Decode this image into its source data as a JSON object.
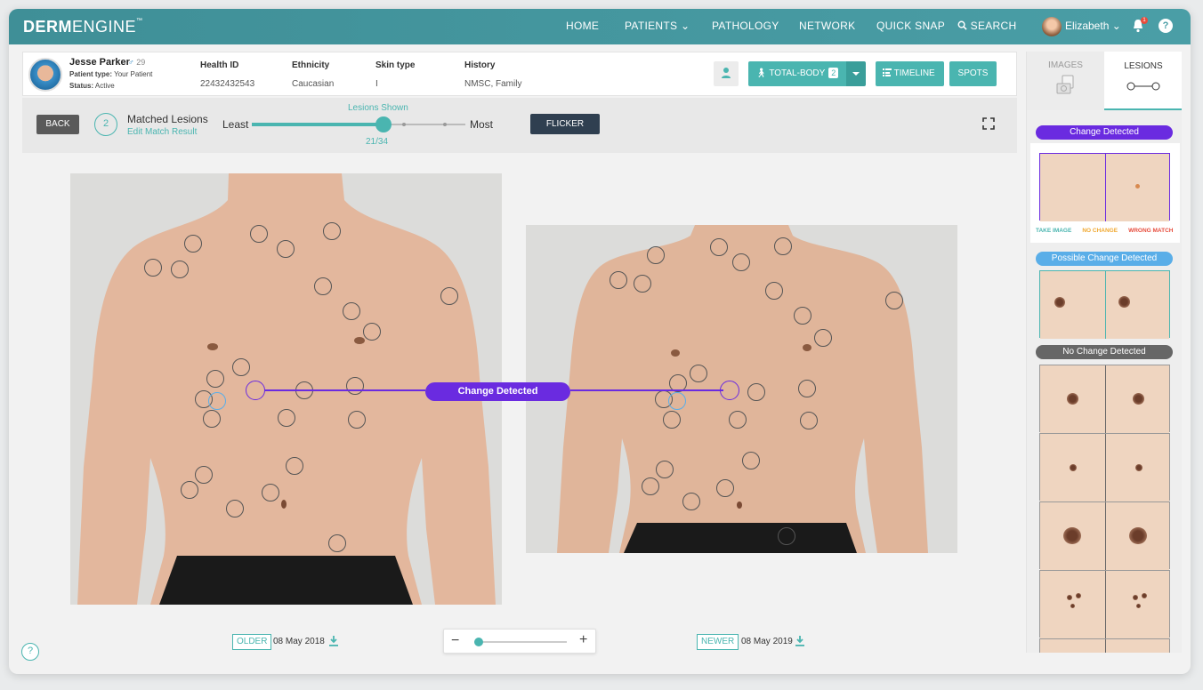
{
  "nav": {
    "logo_bold": "DERM",
    "logo_light": "ENGINE",
    "logo_tm": "™",
    "items": [
      "HOME",
      "PATIENTS",
      "PATHOLOGY",
      "NETWORK",
      "QUICK SNAP",
      "SEARCH"
    ],
    "patients_caret": "⌄",
    "user": "Elizabeth",
    "user_caret": "⌄",
    "notifications": "1",
    "help": "?"
  },
  "patient": {
    "name": "Jesse Parker",
    "age": "29",
    "type_label": "Patient type:",
    "type_value": "Your Patient",
    "status_label": "Status:",
    "status_value": "Active",
    "columns": [
      {
        "header": "Health ID",
        "value": "22432432543"
      },
      {
        "header": "Ethnicity",
        "value": "Caucasian"
      },
      {
        "header": "Skin type",
        "value": "I"
      },
      {
        "header": "History",
        "value": "NMSC, Family"
      }
    ],
    "buttons": {
      "total_body": "TOTAL-BODY",
      "total_body_count": "2",
      "timeline": "TIMELINE",
      "spots": "SPOTS"
    }
  },
  "match": {
    "back": "BACK",
    "count": "2",
    "title": "Matched Lesions",
    "edit": "Edit Match Result",
    "least": "Least",
    "most": "Most",
    "lesions_shown_label": "Lesions Shown",
    "shown": 21,
    "total": 34,
    "shown_text": "21/34",
    "flicker": "FLICKER"
  },
  "comparison": {
    "change_label": "Change Detected",
    "older_tag": "OLDER",
    "older_date": "08 May 2018",
    "newer_tag": "NEWER",
    "newer_date": "08 May 2019",
    "zoom_minus": "−",
    "zoom_plus": "+",
    "zoom_level": 0.05
  },
  "right_panel": {
    "tabs": {
      "images": "IMAGES",
      "lesions": "LESIONS"
    },
    "categories": [
      {
        "label": "Change Detected",
        "color": "#6a2be0"
      },
      {
        "label": "Possible Change Detected",
        "color": "#5aaee8"
      },
      {
        "label": "No Change Detected",
        "color": "#666666"
      }
    ],
    "actions": [
      {
        "label": "TAKE IMAGE",
        "color": "#4ab5b0"
      },
      {
        "label": "NO CHANGE",
        "color": "#f0a830"
      },
      {
        "label": "WRONG MATCH",
        "color": "#e74c3c"
      }
    ]
  },
  "help_button": "?",
  "colors": {
    "accent": "#4ab5b0",
    "change": "#6a2be0",
    "possible_change": "#5aaee8",
    "nav": "#4a9ea6"
  }
}
